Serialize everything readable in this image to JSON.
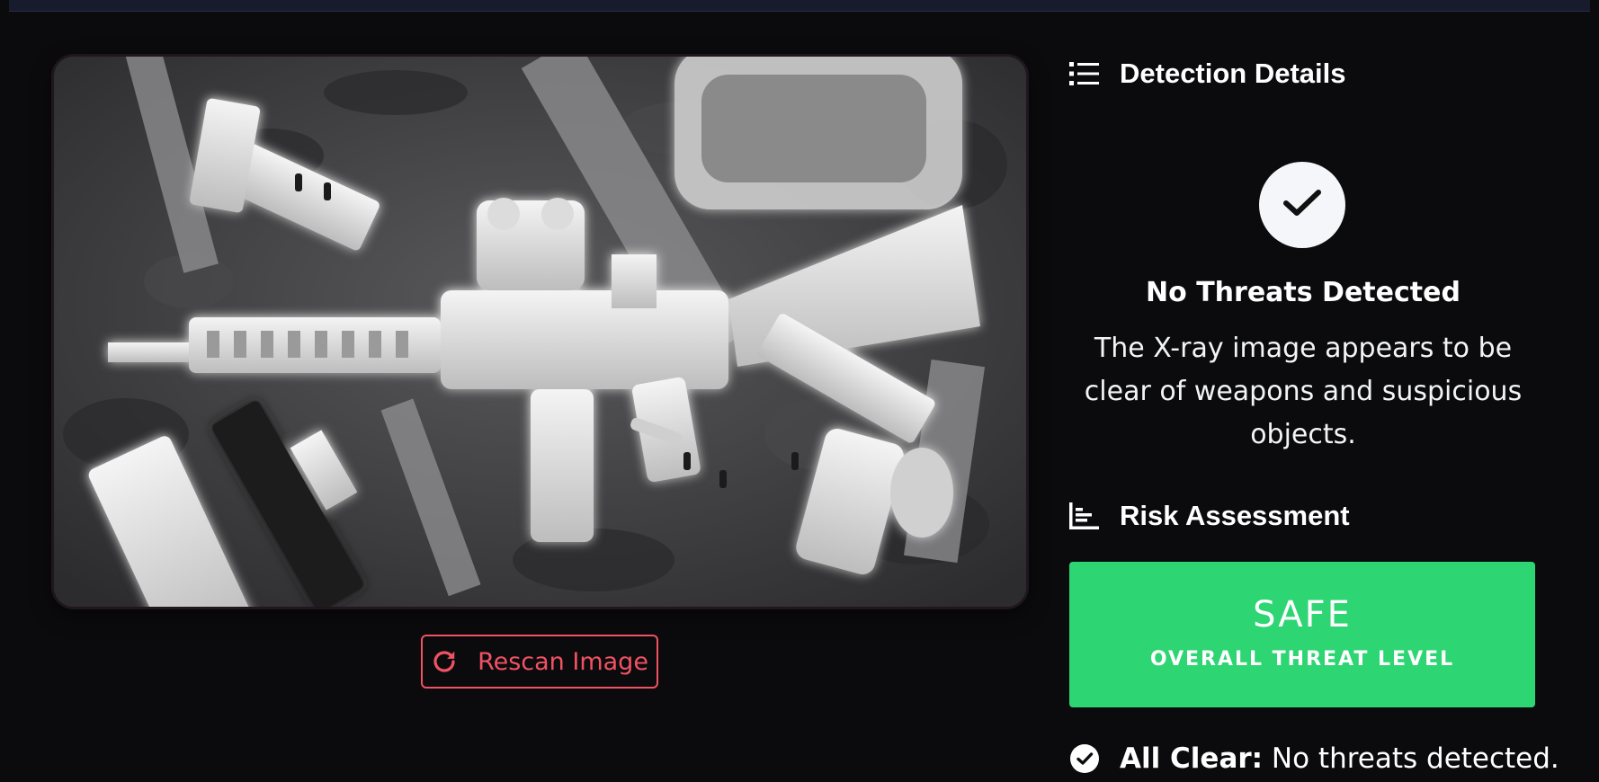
{
  "scan": {
    "rescan_label": "Rescan Image",
    "rescan_icon": "refresh-icon"
  },
  "detection": {
    "heading": "Detection Details",
    "heading_icon": "list-icon",
    "status_icon": "check-icon",
    "status_title": "No Threats Detected",
    "status_description": "The X-ray image appears to be clear of weapons and suspicious objects."
  },
  "risk": {
    "heading": "Risk Assessment",
    "heading_icon": "bar-chart-icon",
    "level": "SAFE",
    "level_caption": "OVERALL THREAT LEVEL",
    "level_color": "#2ed573",
    "summary_label": "All Clear:",
    "summary_text": "No threats detected.",
    "summary_icon": "check-circle-icon"
  },
  "colors": {
    "background": "#0b0b0d",
    "accent_danger": "#f05263",
    "safe": "#2ed573"
  }
}
